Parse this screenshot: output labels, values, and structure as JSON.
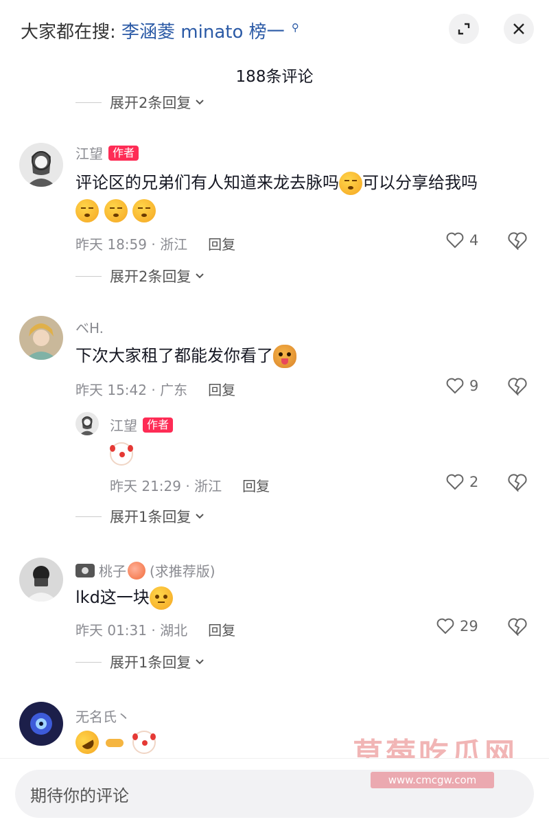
{
  "header": {
    "search_prefix": "大家都在搜:",
    "search_keyword": "李涵菱 minato 榜一",
    "search_icon": "search-icon",
    "expand_icon": "collapse-icon",
    "close_icon": "close-icon"
  },
  "comment_count": "188条评论",
  "top_expand": "展开2条回复",
  "comments": [
    {
      "name": "江望",
      "badge": "作者",
      "text_a": "评论区的兄弟们有人知道来龙去脉吗",
      "text_b": "可以分享给我吗",
      "time": "昨天 18:59 · 浙江",
      "reply": "回复",
      "likes": "4",
      "expand": "展开2条回复"
    },
    {
      "name": "ベH.",
      "text": "下次大家租了都能发你看了",
      "time": "昨天 15:42 · 广东",
      "reply": "回复",
      "likes": "9",
      "sub_reply": {
        "name": "江望",
        "badge": "作者",
        "time": "昨天 21:29 · 浙江",
        "reply": "回复",
        "likes": "2"
      },
      "expand": "展开1条回复"
    },
    {
      "name": "桃子",
      "name_suffix": "(求推荐版)",
      "text": "lkd这一块",
      "time": "昨天 01:31 · 湖北",
      "reply": "回复",
      "likes": "29",
      "expand": "展开1条回复"
    },
    {
      "name": "无名氏丶"
    }
  ],
  "input_placeholder": "期待你的评论",
  "watermark": "草莓吃瓜网",
  "watermark_url": "www.cmcgw.com",
  "colors": {
    "author_badge": "#fe2c55",
    "keyword": "#2b5aa6"
  }
}
